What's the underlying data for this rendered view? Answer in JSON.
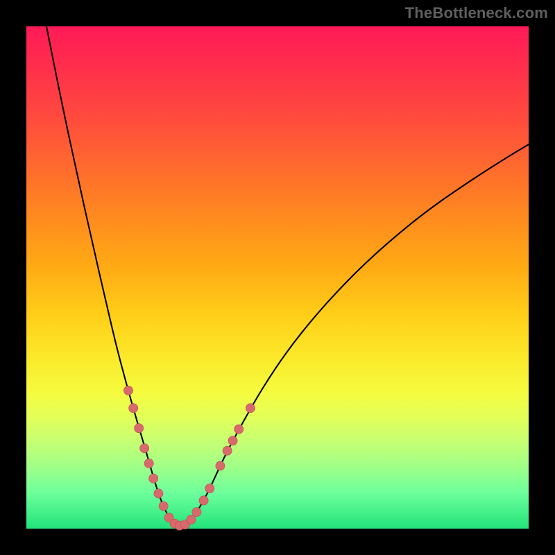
{
  "watermark": {
    "text": "TheBottleneck.com"
  },
  "chart_data": {
    "type": "line",
    "title": "",
    "xlabel": "",
    "ylabel": "",
    "xlim": [
      0,
      100
    ],
    "ylim": [
      0,
      100
    ],
    "grid": false,
    "series": [
      {
        "name": "curve",
        "points": [
          {
            "x": 4.0,
            "y": 100.0
          },
          {
            "x": 7.0,
            "y": 85.0
          },
          {
            "x": 10.0,
            "y": 71.0
          },
          {
            "x": 13.0,
            "y": 57.5
          },
          {
            "x": 16.0,
            "y": 44.5
          },
          {
            "x": 18.0,
            "y": 36.0
          },
          {
            "x": 20.0,
            "y": 28.5
          },
          {
            "x": 22.0,
            "y": 21.5
          },
          {
            "x": 24.0,
            "y": 14.8
          },
          {
            "x": 25.5,
            "y": 9.5
          },
          {
            "x": 27.0,
            "y": 5.0
          },
          {
            "x": 28.5,
            "y": 2.0
          },
          {
            "x": 29.8,
            "y": 0.7
          },
          {
            "x": 31.2,
            "y": 0.6
          },
          {
            "x": 33.0,
            "y": 2.0
          },
          {
            "x": 35.0,
            "y": 5.0
          },
          {
            "x": 37.0,
            "y": 9.0
          },
          {
            "x": 39.5,
            "y": 14.5
          },
          {
            "x": 43.0,
            "y": 21.0
          },
          {
            "x": 47.0,
            "y": 28.0
          },
          {
            "x": 52.0,
            "y": 35.5
          },
          {
            "x": 58.0,
            "y": 43.0
          },
          {
            "x": 65.0,
            "y": 50.5
          },
          {
            "x": 72.0,
            "y": 57.0
          },
          {
            "x": 80.0,
            "y": 63.5
          },
          {
            "x": 88.0,
            "y": 69.0
          },
          {
            "x": 95.0,
            "y": 73.5
          },
          {
            "x": 100.0,
            "y": 76.5
          }
        ]
      },
      {
        "name": "dots",
        "points": [
          {
            "x": 20.3,
            "y": 27.5
          },
          {
            "x": 21.3,
            "y": 24.0
          },
          {
            "x": 22.4,
            "y": 20.0
          },
          {
            "x": 23.5,
            "y": 16.0
          },
          {
            "x": 24.4,
            "y": 13.0
          },
          {
            "x": 25.3,
            "y": 10.0
          },
          {
            "x": 26.3,
            "y": 7.0
          },
          {
            "x": 27.3,
            "y": 4.5
          },
          {
            "x": 28.4,
            "y": 2.2
          },
          {
            "x": 29.5,
            "y": 1.0
          },
          {
            "x": 30.5,
            "y": 0.6
          },
          {
            "x": 31.6,
            "y": 0.8
          },
          {
            "x": 32.8,
            "y": 1.8
          },
          {
            "x": 33.9,
            "y": 3.3
          },
          {
            "x": 35.3,
            "y": 5.6
          },
          {
            "x": 36.5,
            "y": 8.0
          },
          {
            "x": 38.6,
            "y": 12.5
          },
          {
            "x": 40.0,
            "y": 15.5
          },
          {
            "x": 41.1,
            "y": 17.5
          },
          {
            "x": 42.3,
            "y": 19.8
          },
          {
            "x": 44.6,
            "y": 24.0
          }
        ]
      }
    ],
    "colors": {
      "curve": "#000000",
      "dots_fill": "#d86a6d",
      "dots_stroke": "#b74f52"
    }
  }
}
